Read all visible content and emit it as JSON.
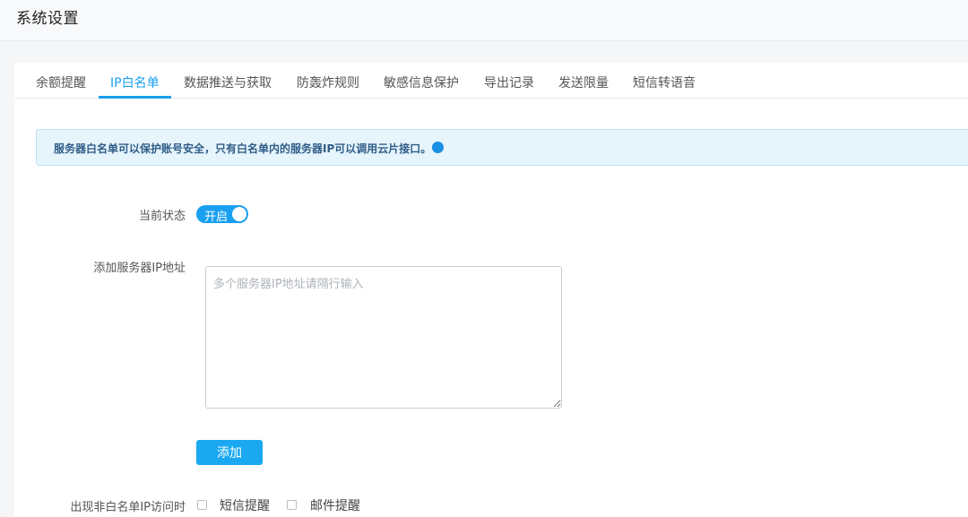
{
  "header": {
    "title": "系统设置"
  },
  "tabs": [
    {
      "label": "余额提醒",
      "active": false
    },
    {
      "label": "IP白名单",
      "active": true
    },
    {
      "label": "数据推送与获取",
      "active": false
    },
    {
      "label": "防轰炸规则",
      "active": false
    },
    {
      "label": "敏感信息保护",
      "active": false
    },
    {
      "label": "导出记录",
      "active": false
    },
    {
      "label": "发送限量",
      "active": false
    },
    {
      "label": "短信转语音",
      "active": false
    }
  ],
  "notice": {
    "text": "服务器白名单可以保护账号安全，只有白名单内的服务器IP可以调用云片接口。"
  },
  "form": {
    "status_label": "当前状态",
    "status_switch": {
      "text": "开启",
      "on": true
    },
    "ip_label": "添加服务器IP地址",
    "ip_input": {
      "value": "",
      "placeholder": "多个服务器IP地址请隔行输入"
    },
    "add_button": "添加",
    "alert_label": "出现非白名单IP访问时",
    "alert_options": [
      {
        "label": "短信提醒",
        "checked": false
      },
      {
        "label": "邮件提醒",
        "checked": false
      }
    ]
  },
  "colors": {
    "accent": "#1aa0f0",
    "notice_bg": "#e6f4fc",
    "notice_text": "#2f5d87"
  }
}
